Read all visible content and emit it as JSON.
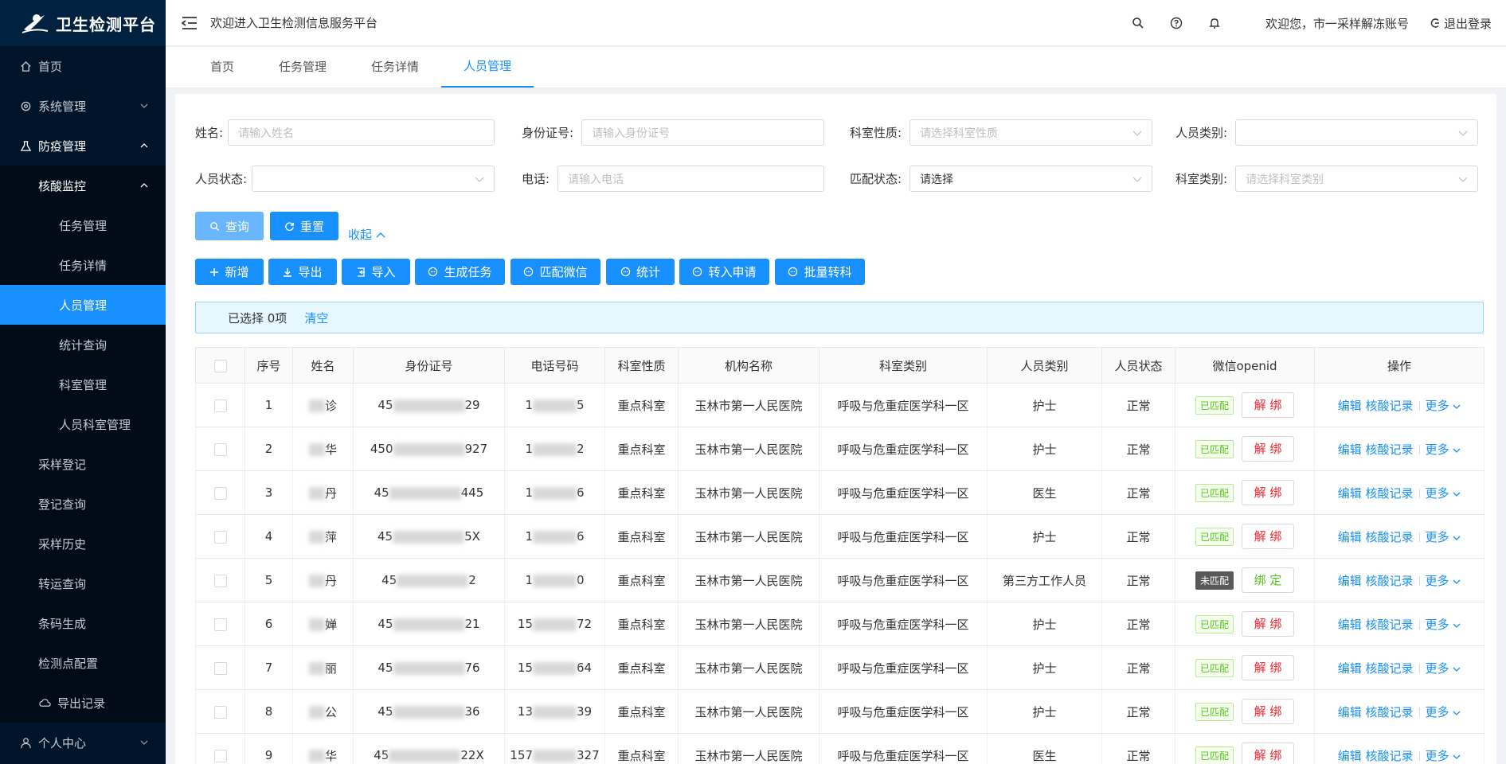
{
  "app": {
    "title": "卫生检测平台"
  },
  "sidebar": {
    "items": [
      {
        "label": "首页",
        "icon": "home-icon"
      },
      {
        "label": "系统管理",
        "icon": "gear-icon"
      },
      {
        "label": "防疫管理",
        "icon": "flask-icon"
      },
      {
        "label": "核酸监控"
      },
      {
        "label": "任务管理"
      },
      {
        "label": "任务详情"
      },
      {
        "label": "人员管理"
      },
      {
        "label": "统计查询"
      },
      {
        "label": "科室管理"
      },
      {
        "label": "人员科室管理"
      },
      {
        "label": "采样登记"
      },
      {
        "label": "登记查询"
      },
      {
        "label": "采样历史"
      },
      {
        "label": "转运查询"
      },
      {
        "label": "条码生成"
      },
      {
        "label": "检测点配置"
      },
      {
        "label": "导出记录",
        "icon": "cloud-icon"
      },
      {
        "label": "个人中心",
        "icon": "user-icon"
      }
    ]
  },
  "header": {
    "welcome": "欢迎进入卫生检测信息服务平台",
    "user": "欢迎您，市一采样解冻账号",
    "logout": "退出登录"
  },
  "tabs": [
    "首页",
    "任务管理",
    "任务详情",
    "人员管理"
  ],
  "filters": {
    "name": {
      "label": "姓名:",
      "placeholder": "请输入姓名"
    },
    "idcard": {
      "label": "身份证号:",
      "placeholder": "请输入身份证号"
    },
    "dept_nature": {
      "label": "科室性质:",
      "placeholder": "请选择科室性质"
    },
    "person_type": {
      "label": "人员类别:",
      "placeholder": ""
    },
    "person_status": {
      "label": "人员状态:",
      "placeholder": ""
    },
    "phone": {
      "label": "电话:",
      "placeholder": "请输入电话"
    },
    "match_status": {
      "label": "匹配状态:",
      "value": "请选择"
    },
    "dept_type": {
      "label": "科室类别:",
      "placeholder": "请选择科室类别"
    }
  },
  "buttons": {
    "query": "查询",
    "reset": "重置",
    "collapse": "收起",
    "add": "新增",
    "export": "导出",
    "import": "导入",
    "gen_task": "生成任务",
    "match_wechat": "匹配微信",
    "stats": "统计",
    "transfer": "转入申请",
    "batch": "批量转科"
  },
  "selection": {
    "text": "已选择 0项",
    "clear": "清空"
  },
  "table": {
    "headers": [
      "",
      "序号",
      "姓名",
      "身份证号",
      "电话号码",
      "科室性质",
      "机构名称",
      "科室类别",
      "人员类别",
      "人员状态",
      "微信openid",
      "操作"
    ],
    "rows": [
      {
        "no": "1",
        "name": "诊",
        "id_pre": "45",
        "id_suf": "29",
        "phone_pre": "1",
        "phone_suf": "5",
        "nature": "重点科室",
        "org": "玉林市第一人民医院",
        "dept": "呼吸与危重症医学科一区",
        "ptype": "护士",
        "status": "正常",
        "wx": "已匹配",
        "bind": "解 绑"
      },
      {
        "no": "2",
        "name": "华",
        "id_pre": "450",
        "id_suf": "927",
        "phone_pre": "1",
        "phone_suf": "2",
        "nature": "重点科室",
        "org": "玉林市第一人民医院",
        "dept": "呼吸与危重症医学科一区",
        "ptype": "护士",
        "status": "正常",
        "wx": "已匹配",
        "bind": "解 绑"
      },
      {
        "no": "3",
        "name": "丹",
        "id_pre": "45",
        "id_suf": "445",
        "phone_pre": "1",
        "phone_suf": "6",
        "nature": "重点科室",
        "org": "玉林市第一人民医院",
        "dept": "呼吸与危重症医学科一区",
        "ptype": "医生",
        "status": "正常",
        "wx": "已匹配",
        "bind": "解 绑"
      },
      {
        "no": "4",
        "name": "萍",
        "id_pre": "45",
        "id_suf": "5X",
        "phone_pre": "1",
        "phone_suf": "6",
        "nature": "重点科室",
        "org": "玉林市第一人民医院",
        "dept": "呼吸与危重症医学科一区",
        "ptype": "护士",
        "status": "正常",
        "wx": "已匹配",
        "bind": "解 绑"
      },
      {
        "no": "5",
        "name": "丹",
        "id_pre": "45",
        "id_suf": "2",
        "phone_pre": "1",
        "phone_suf": "0",
        "nature": "重点科室",
        "org": "玉林市第一人民医院",
        "dept": "呼吸与危重症医学科一区",
        "ptype": "第三方工作人员",
        "status": "正常",
        "wx": "未匹配",
        "bind": "绑 定"
      },
      {
        "no": "6",
        "name": "婵",
        "id_pre": "45",
        "id_suf": "21",
        "phone_pre": "15",
        "phone_suf": "72",
        "nature": "重点科室",
        "org": "玉林市第一人民医院",
        "dept": "呼吸与危重症医学科一区",
        "ptype": "护士",
        "status": "正常",
        "wx": "已匹配",
        "bind": "解 绑"
      },
      {
        "no": "7",
        "name": "丽",
        "id_pre": "45",
        "id_suf": "76",
        "phone_pre": "15",
        "phone_suf": "64",
        "nature": "重点科室",
        "org": "玉林市第一人民医院",
        "dept": "呼吸与危重症医学科一区",
        "ptype": "护士",
        "status": "正常",
        "wx": "已匹配",
        "bind": "解 绑"
      },
      {
        "no": "8",
        "name": "公",
        "id_pre": "45",
        "id_suf": "36",
        "phone_pre": "13",
        "phone_suf": "39",
        "nature": "重点科室",
        "org": "玉林市第一人民医院",
        "dept": "呼吸与危重症医学科一区",
        "ptype": "护士",
        "status": "正常",
        "wx": "已匹配",
        "bind": "解 绑"
      },
      {
        "no": "9",
        "name": "华",
        "id_pre": "45",
        "id_suf": "22X",
        "phone_pre": "157",
        "phone_suf": "327",
        "nature": "重点科室",
        "org": "玉林市第一人民医院",
        "dept": "呼吸与危重症医学科一区",
        "ptype": "医生",
        "status": "正常",
        "wx": "已匹配",
        "bind": "解 绑"
      }
    ],
    "ops": {
      "edit": "编辑",
      "records": "核酸记录",
      "more": "更多"
    }
  },
  "colors": {
    "primary": "#1890ff",
    "sidebar": "#001529",
    "danger": "#f5222d",
    "success": "#52c41a"
  }
}
